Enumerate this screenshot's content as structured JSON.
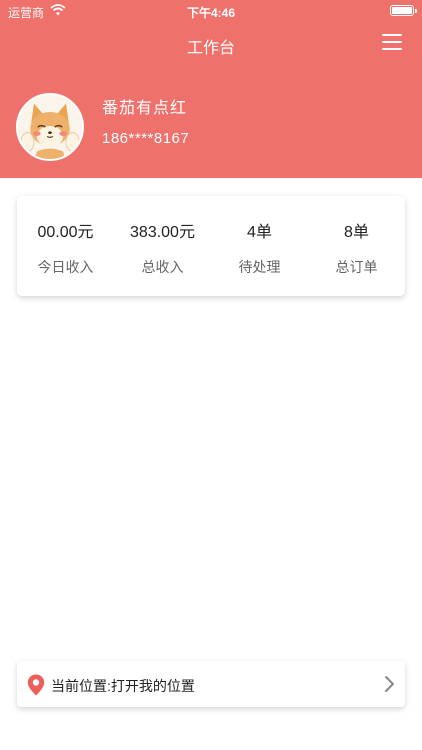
{
  "status_bar": {
    "carrier": "运营商",
    "time": "下午4:46"
  },
  "nav": {
    "title": "工作台"
  },
  "profile": {
    "name": "番茄有点红",
    "phone": "186****8167"
  },
  "stats": [
    {
      "value": "00.00元",
      "label": "今日收入"
    },
    {
      "value": "383.00元",
      "label": "总收入"
    },
    {
      "value": "4单",
      "label": "待处理"
    },
    {
      "value": "8单",
      "label": "总订单"
    }
  ],
  "location": {
    "text": "当前位置:打开我的位置"
  },
  "colors": {
    "accent": "#ee716b",
    "pin": "#ee5f5b"
  },
  "icons": [
    "wifi-icon",
    "battery-icon",
    "menu-icon",
    "avatar-shiba",
    "location-pin-icon",
    "chevron-right-icon"
  ]
}
